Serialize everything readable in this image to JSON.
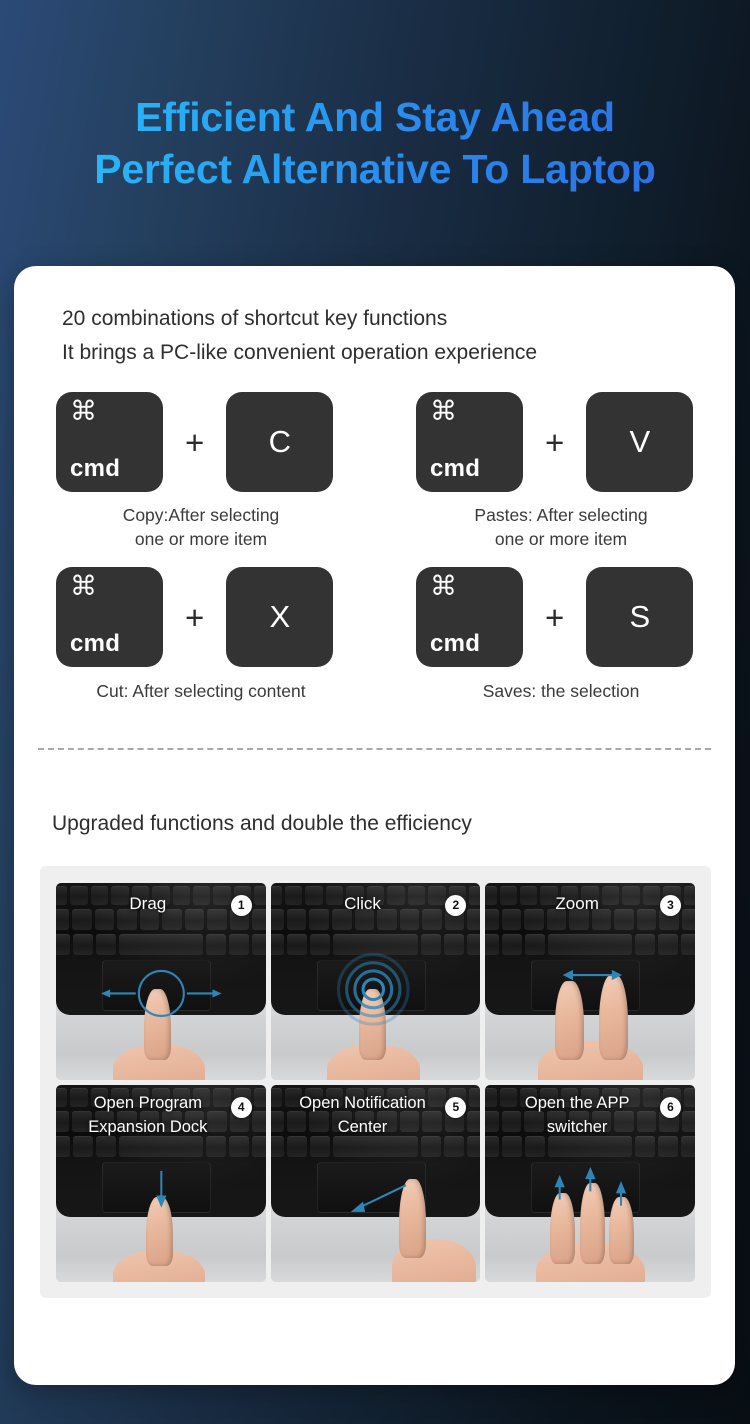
{
  "hero": {
    "line1": "Efficient And Stay Ahead",
    "line2": "Perfect Alternative To Laptop",
    "gradient_from": "#2ec0fb",
    "gradient_to": "#2f69e2"
  },
  "intro": {
    "line1": "20 combinations of shortcut key functions",
    "line2": "It brings a PC-like convenient operation experience"
  },
  "shortcuts": [
    {
      "modifier_glyph": "⌘",
      "modifier_label": "cmd",
      "key": "C",
      "plus": "+",
      "caption_line1": "Copy:After selecting",
      "caption_line2": "one or more item"
    },
    {
      "modifier_glyph": "⌘",
      "modifier_label": "cmd",
      "key": "V",
      "plus": "+",
      "caption_line1": "Pastes: After selecting",
      "caption_line2": "one or more item"
    },
    {
      "modifier_glyph": "⌘",
      "modifier_label": "cmd",
      "key": "X",
      "plus": "+",
      "caption_line1": "Cut: After selecting content",
      "caption_line2": ""
    },
    {
      "modifier_glyph": "⌘",
      "modifier_label": "cmd",
      "key": "S",
      "plus": "+",
      "caption_line1": "Saves: the selection",
      "caption_line2": ""
    }
  ],
  "upgraded": {
    "title": "Upgraded functions and double the efficiency",
    "cells": [
      {
        "label_line1": "Drag",
        "label_line2": "",
        "badge": "1",
        "gesture": "drag-horizontal"
      },
      {
        "label_line1": "Click",
        "label_line2": "",
        "badge": "2",
        "gesture": "tap-ripple"
      },
      {
        "label_line1": "Zoom",
        "label_line2": "",
        "badge": "3",
        "gesture": "two-finger-spread"
      },
      {
        "label_line1": "Open Program",
        "label_line2": "Expansion Dock",
        "badge": "4",
        "gesture": "swipe-down"
      },
      {
        "label_line1": "Open Notification",
        "label_line2": "Center",
        "badge": "5",
        "gesture": "swipe-diagonal-left"
      },
      {
        "label_line1": "Open the APP",
        "label_line2": "switcher",
        "badge": "6",
        "gesture": "three-finger-up"
      }
    ]
  },
  "colors": {
    "accent_cyan": "#2ec0fb",
    "accent_blue": "#2f69e2",
    "gesture_arrow": "#2e86b8",
    "keycap": "#333333",
    "card": "#ffffff",
    "panel": "#efefef"
  }
}
